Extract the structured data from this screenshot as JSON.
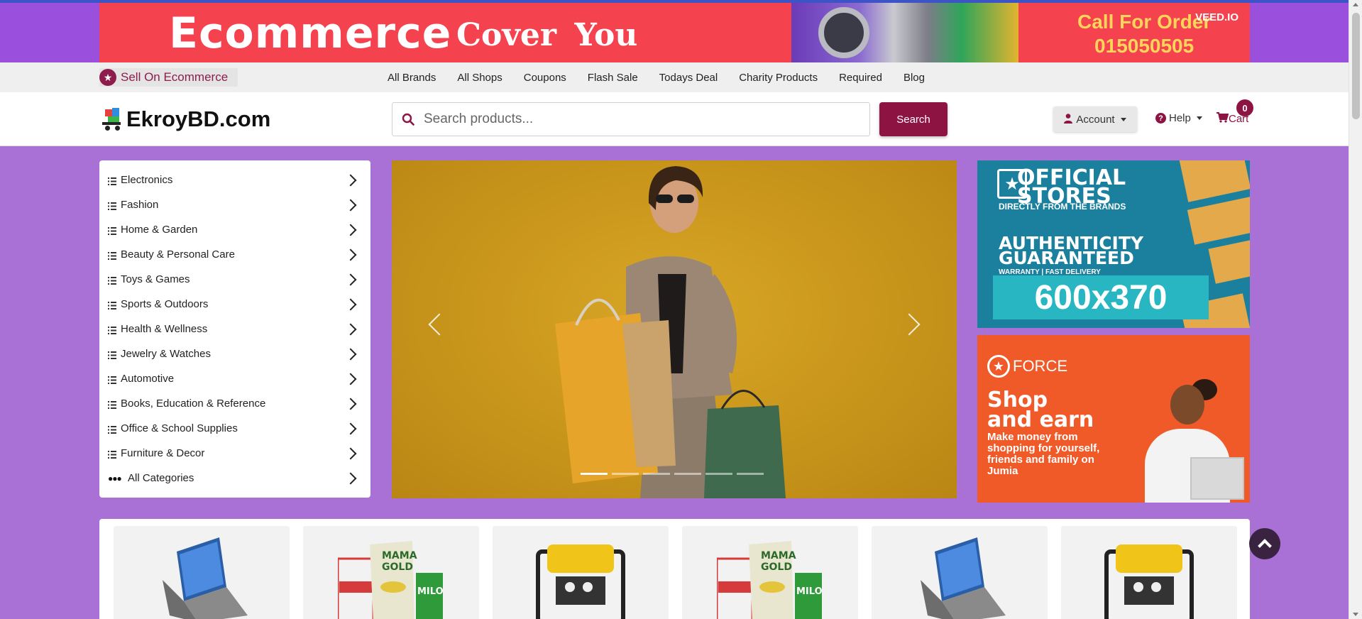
{
  "banner": {
    "title": "Ecommerce",
    "subtitle": "Cover  You",
    "call_line1": "Call For Order",
    "call_line2": "015050505",
    "watermark": "VEED.IO"
  },
  "topnav": {
    "sell_label": "Sell On Ecommerce",
    "links": [
      "All Brands",
      "All Shops",
      "Coupons",
      "Flash Sale",
      "Todays Deal",
      "Charity Products",
      "Required",
      "Blog"
    ]
  },
  "header": {
    "logo_text": "EkroyBD.com",
    "search_placeholder": "Search products...",
    "search_button": "Search",
    "account_label": "Account",
    "help_label": "Help",
    "cart_label": "Cart",
    "cart_count": "0"
  },
  "categories": {
    "items": [
      "Electronics",
      "Fashion",
      "Home & Garden",
      "Beauty & Personal Care",
      "Toys & Games",
      "Sports & Outdoors",
      "Health & Wellness",
      "Jewelry & Watches",
      "Automotive",
      "Books, Education & Reference",
      "Office & School Supplies",
      "Furniture & Decor"
    ],
    "all_label": "All Categories"
  },
  "carousel": {
    "slide_count": 6,
    "active_index": 0
  },
  "ads": {
    "ad1": {
      "title_line1": "OFFICIAL",
      "title_line2": "STORES",
      "sub": "DIRECTLY FROM THE BRANDS",
      "auth_line1": "AUTHENTICITY",
      "auth_line2": "GUARANTEED",
      "warranty": "WARRANTY | FAST DELIVERY",
      "size": "600x370"
    },
    "ad2": {
      "brand": "FORCE",
      "headline_line1": "Shop",
      "headline_line2": "and earn",
      "description": "Make money from shopping for yourself, friends and family on Jumia"
    }
  },
  "products": [
    "laptop",
    "noodles-pack",
    "generator",
    "noodles-pack",
    "laptop",
    "generator"
  ],
  "colors": {
    "brand": "#8d1343",
    "page_bg": "#a970d6",
    "banner_bg": "#f4424f"
  }
}
